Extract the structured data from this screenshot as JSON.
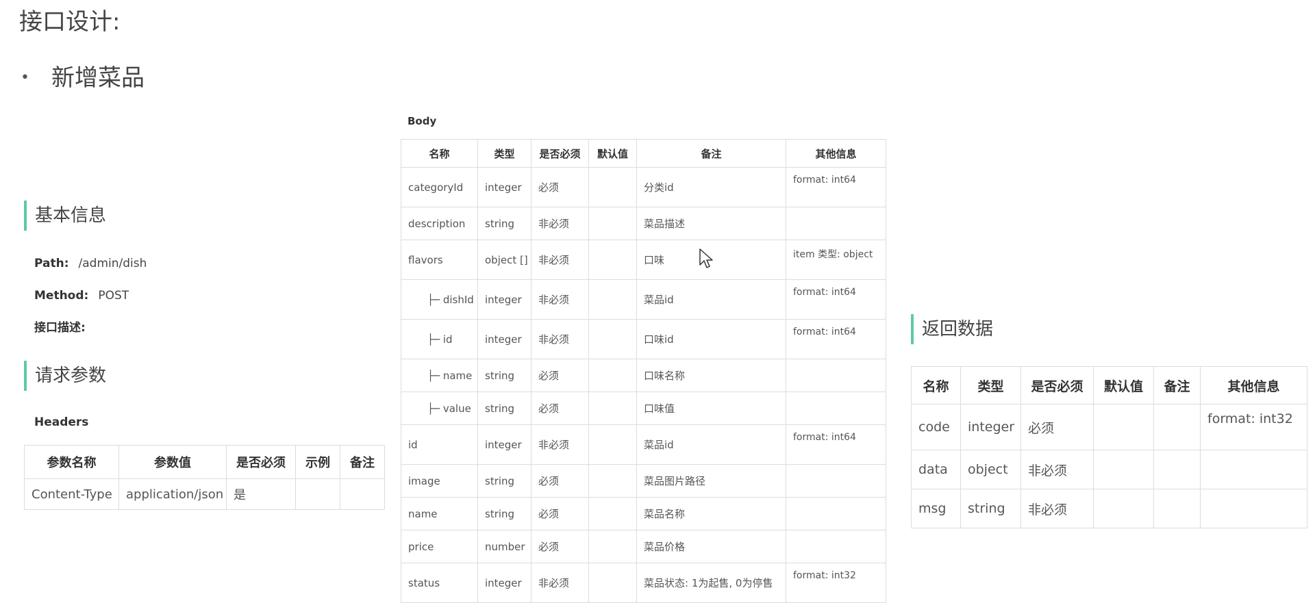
{
  "page_title": "接口设计:",
  "bullet": "新增菜品",
  "basic_info": {
    "heading": "基本信息",
    "path_label": "Path:",
    "path_value": "/admin/dish",
    "method_label": "Method:",
    "method_value": "POST",
    "desc_label": "接口描述:"
  },
  "request_params": {
    "heading": "请求参数",
    "headers_label": "Headers",
    "headers_table": {
      "columns": [
        "参数名称",
        "参数值",
        "是否必须",
        "示例",
        "备注"
      ],
      "rows": [
        [
          "Content-Type",
          "application/json",
          "是",
          "",
          ""
        ]
      ]
    }
  },
  "body": {
    "label": "Body",
    "columns": [
      "名称",
      "类型",
      "是否必须",
      "默认值",
      "备注",
      "其他信息"
    ],
    "rows": [
      {
        "name": "categoryId",
        "type": "integer",
        "required": "必须",
        "default": "",
        "note": "分类id",
        "info": "format: int64",
        "child": false
      },
      {
        "name": "description",
        "type": "string",
        "required": "非必须",
        "default": "",
        "note": "菜品描述",
        "info": "",
        "child": false
      },
      {
        "name": "flavors",
        "type": "object []",
        "required": "非必须",
        "default": "",
        "note": "口味",
        "info": "item 类型: object",
        "child": false
      },
      {
        "name": "├─ dishId",
        "type": "integer",
        "required": "非必须",
        "default": "",
        "note": "菜品id",
        "info": "format: int64",
        "child": true
      },
      {
        "name": "├─ id",
        "type": "integer",
        "required": "非必须",
        "default": "",
        "note": "口味id",
        "info": "format: int64",
        "child": true
      },
      {
        "name": "├─ name",
        "type": "string",
        "required": "必须",
        "default": "",
        "note": "口味名称",
        "info": "",
        "child": true
      },
      {
        "name": "├─ value",
        "type": "string",
        "required": "必须",
        "default": "",
        "note": "口味值",
        "info": "",
        "child": true
      },
      {
        "name": "id",
        "type": "integer",
        "required": "非必须",
        "default": "",
        "note": "菜品id",
        "info": "format: int64",
        "child": false
      },
      {
        "name": "image",
        "type": "string",
        "required": "必须",
        "default": "",
        "note": "菜品图片路径",
        "info": "",
        "child": false
      },
      {
        "name": "name",
        "type": "string",
        "required": "必须",
        "default": "",
        "note": "菜品名称",
        "info": "",
        "child": false
      },
      {
        "name": "price",
        "type": "number",
        "required": "必须",
        "default": "",
        "note": "菜品价格",
        "info": "",
        "child": false
      },
      {
        "name": "status",
        "type": "integer",
        "required": "非必须",
        "default": "",
        "note": "菜品状态: 1为起售, 0为停售",
        "info": "format: int32",
        "child": false
      }
    ]
  },
  "return_data": {
    "heading": "返回数据",
    "columns": [
      "名称",
      "类型",
      "是否必须",
      "默认值",
      "备注",
      "其他信息"
    ],
    "rows": [
      {
        "name": "code",
        "type": "integer",
        "required": "必须",
        "default": "",
        "note": "",
        "info": "format: int32"
      },
      {
        "name": "data",
        "type": "object",
        "required": "非必须",
        "default": "",
        "note": "",
        "info": ""
      },
      {
        "name": "msg",
        "type": "string",
        "required": "非必须",
        "default": "",
        "note": "",
        "info": ""
      }
    ]
  },
  "colors": {
    "accent": "#5cc9a7",
    "border": "#dcdcdc",
    "text": "#333333"
  },
  "icons": {
    "cursor": "mouse-pointer-icon"
  }
}
